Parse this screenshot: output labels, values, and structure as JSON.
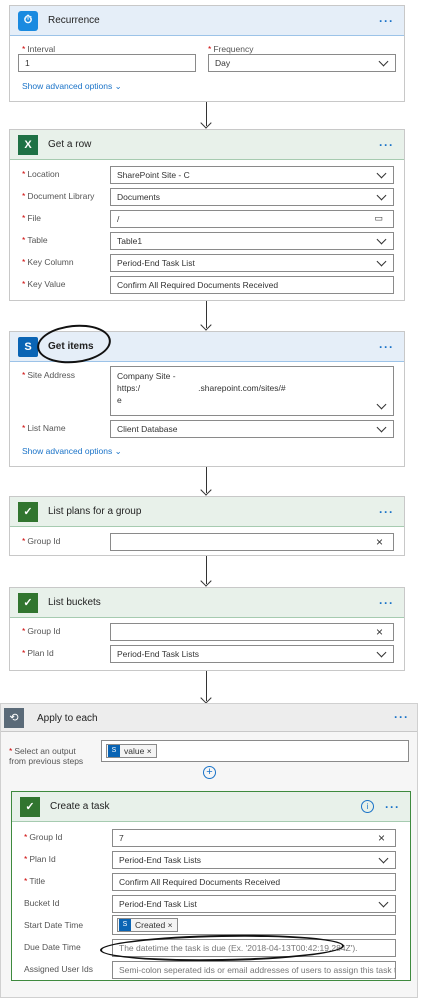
{
  "recurrence": {
    "title": "Recurrence",
    "interval_label": "Interval",
    "interval_value": "1",
    "frequency_label": "Frequency",
    "frequency_value": "Day",
    "advanced": "Show advanced options"
  },
  "get_row": {
    "title": "Get a row",
    "location_label": "Location",
    "location_value": "SharePoint Site - C",
    "library_label": "Document Library",
    "library_value": "Documents",
    "file_label": "File",
    "file_value": "/",
    "table_label": "Table",
    "table_value": "Table1",
    "keycol_label": "Key Column",
    "keycol_value": "Period-End Task List",
    "keyval_label": "Key Value",
    "keyval_value": "Confirm All Required Documents Received"
  },
  "get_items": {
    "title": "Get items",
    "site_label": "Site Address",
    "site_line1": "Company Site -",
    "site_line2_a": "https:/",
    "site_line2_b": ".sharepoint.com/sites/#",
    "site_line3": "e",
    "list_label": "List Name",
    "list_value": "Client Database",
    "advanced": "Show advanced options"
  },
  "list_plans": {
    "title": "List plans for a group",
    "group_label": "Group Id"
  },
  "list_buckets": {
    "title": "List buckets",
    "group_label": "Group Id",
    "plan_label": "Plan Id",
    "plan_value": "Period-End Task Lists"
  },
  "apply": {
    "title": "Apply to each",
    "select_label_1": "Select an output",
    "select_label_2": "from previous steps",
    "token": "value"
  },
  "create_task": {
    "title": "Create a task",
    "group_label": "Group Id",
    "group_value": "7",
    "plan_label": "Plan Id",
    "plan_value": "Period-End Task Lists",
    "title_label": "Title",
    "title_value": "Confirm All Required Documents Received",
    "bucket_label": "Bucket Id",
    "bucket_value": "Period-End Task List",
    "start_label": "Start Date Time",
    "start_token": "Created",
    "due_label": "Due Date Time",
    "due_placeholder": "The datetime the task is due (Ex. '2018-04-13T00:42:19.284Z').",
    "assigned_label": "Assigned User Ids",
    "assigned_placeholder": "Semi-colon seperated ids or email addresses of users to assign this task to."
  },
  "common": {
    "dots": "···",
    "add": "+",
    "x": "×"
  }
}
